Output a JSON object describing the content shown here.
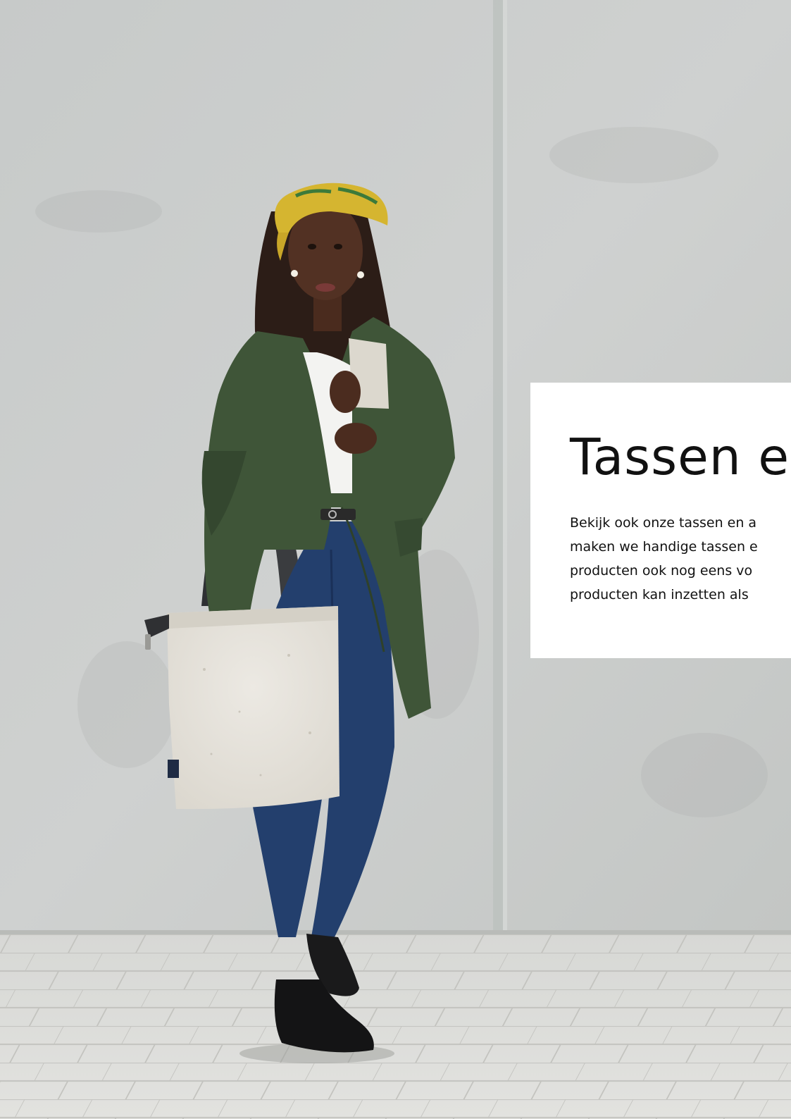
{
  "colors": {
    "wall": "#c9cccb",
    "pavement": "#dcdcd9",
    "card_background": "#ffffff",
    "text": "#111111",
    "jacket": "#3f5538",
    "jeans": "#233f6d",
    "headwrap": "#d5b530",
    "felt_bag": "#e7e4dd"
  },
  "hero_image": {
    "subject_icon": "woman-holding-felt-bag-photo"
  },
  "card": {
    "title": "Tassen en",
    "body_lines": [
      "Bekijk ook onze tassen en a",
      "maken we handige tassen e",
      "producten ook nog eens vo",
      "producten kan inzetten als"
    ]
  }
}
